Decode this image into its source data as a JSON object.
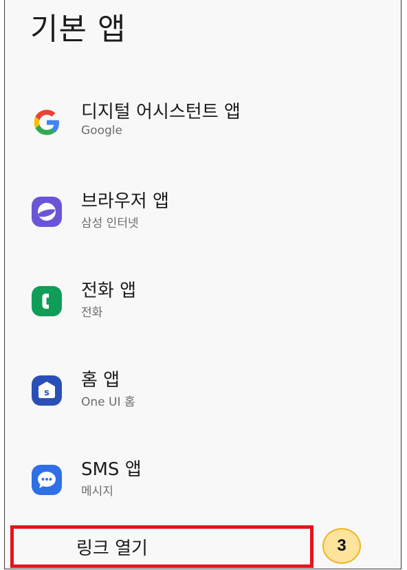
{
  "header": {
    "title": "기본 앱"
  },
  "apps": [
    {
      "title": "디지털 어시스턴트 앱",
      "subtitle": "Google",
      "icon": "google-icon"
    },
    {
      "title": "브라우저 앱",
      "subtitle": "삼성 인터넷",
      "icon": "samsung-internet-icon"
    },
    {
      "title": "전화 앱",
      "subtitle": "전화",
      "icon": "phone-icon"
    },
    {
      "title": "홈 앱",
      "subtitle": "One UI 홈",
      "icon": "one-ui-home-icon"
    },
    {
      "title": "SMS 앱",
      "subtitle": "메시지",
      "icon": "messages-icon"
    }
  ],
  "link_open": {
    "label": "링크 열기"
  },
  "annotation": {
    "step": "3"
  },
  "colors": {
    "highlight_border": "#e8141a",
    "badge_fill": "#fde49a",
    "badge_border": "#f0b323",
    "phone_green": "#0f9d58",
    "browser_purple": "#6a55d8",
    "home_blue": "#2a4fb8",
    "messages_blue": "#2f6fe8"
  }
}
